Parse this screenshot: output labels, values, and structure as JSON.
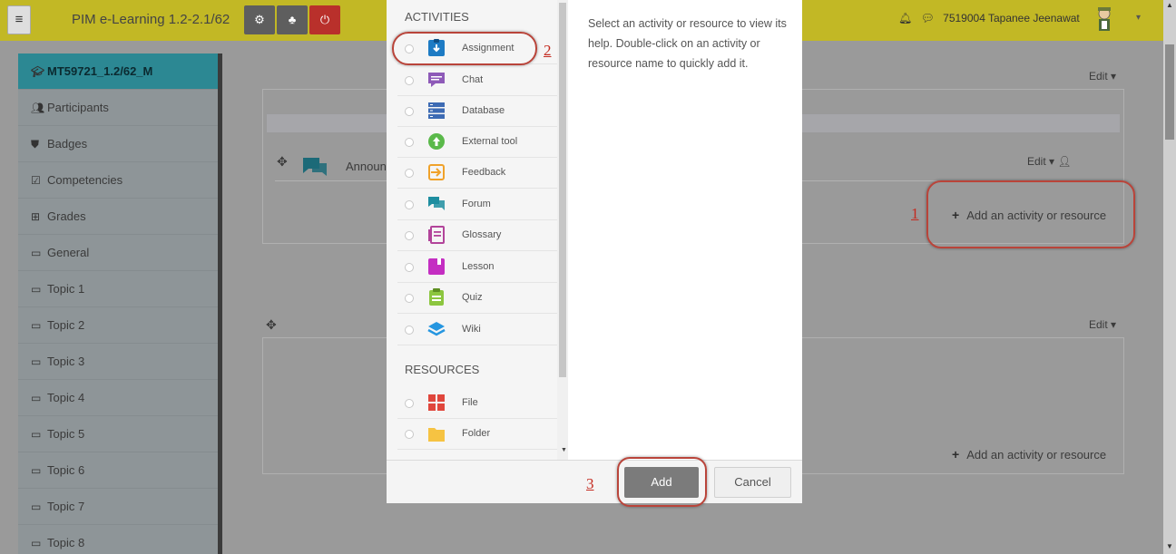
{
  "navbar": {
    "menu_icon": "hamburger-icon",
    "site_title": "PIM e-Learning 1.2-2.1/62",
    "buttons": [
      {
        "name": "admin-settings",
        "icon": "gears-icon"
      },
      {
        "name": "site-structure",
        "icon": "sitemap-icon"
      },
      {
        "name": "logout",
        "icon": "power-icon"
      }
    ],
    "notifications_icon": "bell-icon",
    "messages_icon": "speech-bubble-icon",
    "user_name": "7519004 Tapanee Jeenawat",
    "colors": {
      "bar": "#c2b825",
      "logout": "#b9302b"
    }
  },
  "sidebar": {
    "items": [
      {
        "label": "MT59721_1.2/62_M",
        "icon": "mortarboard-icon",
        "active": true
      },
      {
        "label": "Participants",
        "icon": "users-icon"
      },
      {
        "label": "Badges",
        "icon": "shield-icon"
      },
      {
        "label": "Competencies",
        "icon": "checkbox-icon"
      },
      {
        "label": "Grades",
        "icon": "table-icon"
      },
      {
        "label": "General",
        "icon": "folder-icon"
      },
      {
        "label": "Topic 1",
        "icon": "folder-icon"
      },
      {
        "label": "Topic 2",
        "icon": "folder-icon"
      },
      {
        "label": "Topic 3",
        "icon": "folder-icon"
      },
      {
        "label": "Topic 4",
        "icon": "folder-icon"
      },
      {
        "label": "Topic 5",
        "icon": "folder-icon"
      },
      {
        "label": "Topic 6",
        "icon": "folder-icon"
      },
      {
        "label": "Topic 7",
        "icon": "folder-icon"
      },
      {
        "label": "Topic 8",
        "icon": "folder-icon"
      }
    ],
    "active_color": "#2c8893"
  },
  "main": {
    "section1_edit": "Edit ▾",
    "announcement_label": "Announ",
    "announcement_edit": "Edit ▾",
    "add_activity_1": "Add an activity or resource",
    "section2_edit": "Edit ▾",
    "add_activity_2": "Add an activity or resource"
  },
  "chooser": {
    "activities_title": "ACTIVITIES",
    "activities": [
      {
        "label": "Assignment",
        "icon": "assignment-icon",
        "color": "#1d7bc4"
      },
      {
        "label": "Chat",
        "icon": "chat-icon",
        "color": "#8e5ab8"
      },
      {
        "label": "Database",
        "icon": "database-icon",
        "color": "#3d6bb4"
      },
      {
        "label": "External tool",
        "icon": "external-tool-icon",
        "color": "#5ab94a"
      },
      {
        "label": "Feedback",
        "icon": "feedback-icon",
        "color": "#f0a22a"
      },
      {
        "label": "Forum",
        "icon": "forum-icon",
        "color": "#1e8ea0"
      },
      {
        "label": "Glossary",
        "icon": "glossary-icon",
        "color": "#b2449a"
      },
      {
        "label": "Lesson",
        "icon": "lesson-icon",
        "color": "#c42ec2"
      },
      {
        "label": "Quiz",
        "icon": "quiz-icon",
        "color": "#8cc63f"
      },
      {
        "label": "Wiki",
        "icon": "wiki-icon",
        "color": "#2596e0"
      }
    ],
    "resources_title": "RESOURCES",
    "resources": [
      {
        "label": "File",
        "icon": "file-icon",
        "color": "#e0463c"
      },
      {
        "label": "Folder",
        "icon": "folder-icon",
        "color": "#f6c342"
      }
    ],
    "help_text": "Select an activity or resource to view its help. Double-click on an activity or resource name to quickly add it.",
    "add_button": "Add",
    "cancel_button": "Cancel"
  },
  "annotations": {
    "step1": "1",
    "step2": "2",
    "step3": "3",
    "color": "#c42a1f"
  }
}
